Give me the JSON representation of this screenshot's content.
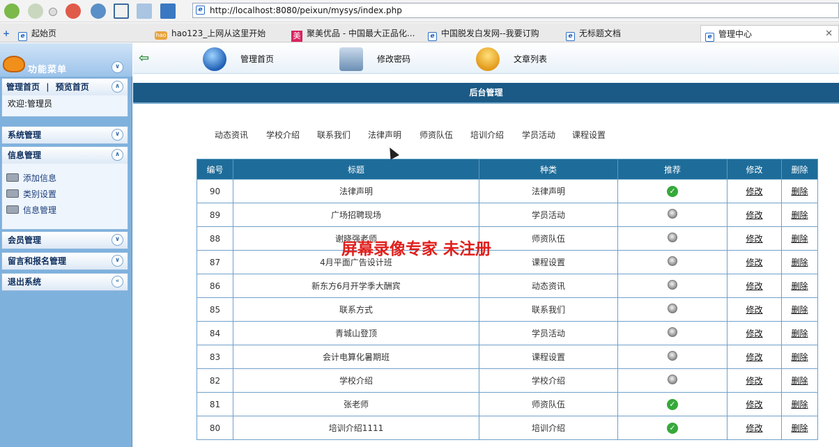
{
  "browser": {
    "url": "http://localhost:8080/peixun/mysys/index.php",
    "tabs": [
      {
        "label": "起始页"
      },
      {
        "label": "hao123_上网从这里开始"
      },
      {
        "label": "聚美优品 - 中国最大正品化..."
      },
      {
        "label": "中国脱发白发网--我要订购"
      },
      {
        "label": "无标题文档"
      },
      {
        "label": "管理中心"
      }
    ]
  },
  "sidebar": {
    "title": "功能菜单",
    "links": {
      "home": "管理首页",
      "separator": "|",
      "preview": "预览首页"
    },
    "welcome": "欢迎:管理员",
    "sections": [
      {
        "label": "系统管理"
      },
      {
        "label": "信息管理",
        "items": [
          "添加信息",
          "类别设置",
          "信息管理"
        ]
      },
      {
        "label": "会员管理"
      },
      {
        "label": "留言和报名管理"
      },
      {
        "label": "退出系统"
      }
    ]
  },
  "topnav": {
    "items": [
      "管理首页",
      "修改密码",
      "文章列表"
    ]
  },
  "banner": "后台管理",
  "categories": [
    "动态资讯",
    "学校介绍",
    "联系我们",
    "法律声明",
    "师资队伍",
    "培训介绍",
    "学员活动",
    "课程设置"
  ],
  "table": {
    "headers": [
      "编号",
      "标题",
      "种类",
      "推荐",
      "修改",
      "删除"
    ],
    "rows": [
      {
        "id": "90",
        "title": "法律声明",
        "type": "法律声明",
        "recommended": true,
        "edit": "修改",
        "del": "删除"
      },
      {
        "id": "89",
        "title": "广场招聘现场",
        "type": "学员活动",
        "recommended": false,
        "edit": "修改",
        "del": "删除"
      },
      {
        "id": "88",
        "title": "谢晓强老师",
        "type": "师资队伍",
        "recommended": false,
        "edit": "修改",
        "del": "删除"
      },
      {
        "id": "87",
        "title": "4月平面广告设计班",
        "type": "课程设置",
        "recommended": false,
        "edit": "修改",
        "del": "删除"
      },
      {
        "id": "86",
        "title": "新东方6月开学季大酬宾",
        "type": "动态资讯",
        "recommended": false,
        "edit": "修改",
        "del": "删除"
      },
      {
        "id": "85",
        "title": "联系方式",
        "type": "联系我们",
        "recommended": false,
        "edit": "修改",
        "del": "删除"
      },
      {
        "id": "84",
        "title": "青城山登顶",
        "type": "学员活动",
        "recommended": false,
        "edit": "修改",
        "del": "删除"
      },
      {
        "id": "83",
        "title": "会计电算化暑期班",
        "type": "课程设置",
        "recommended": false,
        "edit": "修改",
        "del": "删除"
      },
      {
        "id": "82",
        "title": "学校介绍",
        "type": "学校介绍",
        "recommended": false,
        "edit": "修改",
        "del": "删除"
      },
      {
        "id": "81",
        "title": "张老师",
        "type": "师资队伍",
        "recommended": true,
        "edit": "修改",
        "del": "删除"
      },
      {
        "id": "80",
        "title": "培训介绍1111",
        "type": "培训介绍",
        "recommended": true,
        "edit": "修改",
        "del": "删除"
      }
    ]
  },
  "watermark": "屏幕录像专家  未注册",
  "colors": {
    "sidebar_bg": "#7fb1dd",
    "header_bg": "#1e6c99",
    "banner_bg": "#1b5a86",
    "watermark": "#e0201d",
    "recommended": "#35a93a"
  }
}
